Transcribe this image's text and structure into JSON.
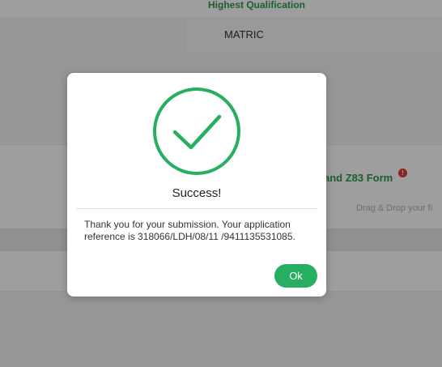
{
  "background": {
    "qualification_label": "Highest Qualification",
    "qualification_value": "MATRIC",
    "upload_title": "and Z83 Form",
    "info_icon": "!",
    "drag_text": "Drag & Drop your fi"
  },
  "modal": {
    "icon": "check-circle-icon",
    "title": "Success!",
    "message": "Thank you for your submission. Your application reference is 318066/LDH/08/11 /9411135531085.",
    "ok_label": "Ok",
    "accent_color": "#27ae60"
  }
}
